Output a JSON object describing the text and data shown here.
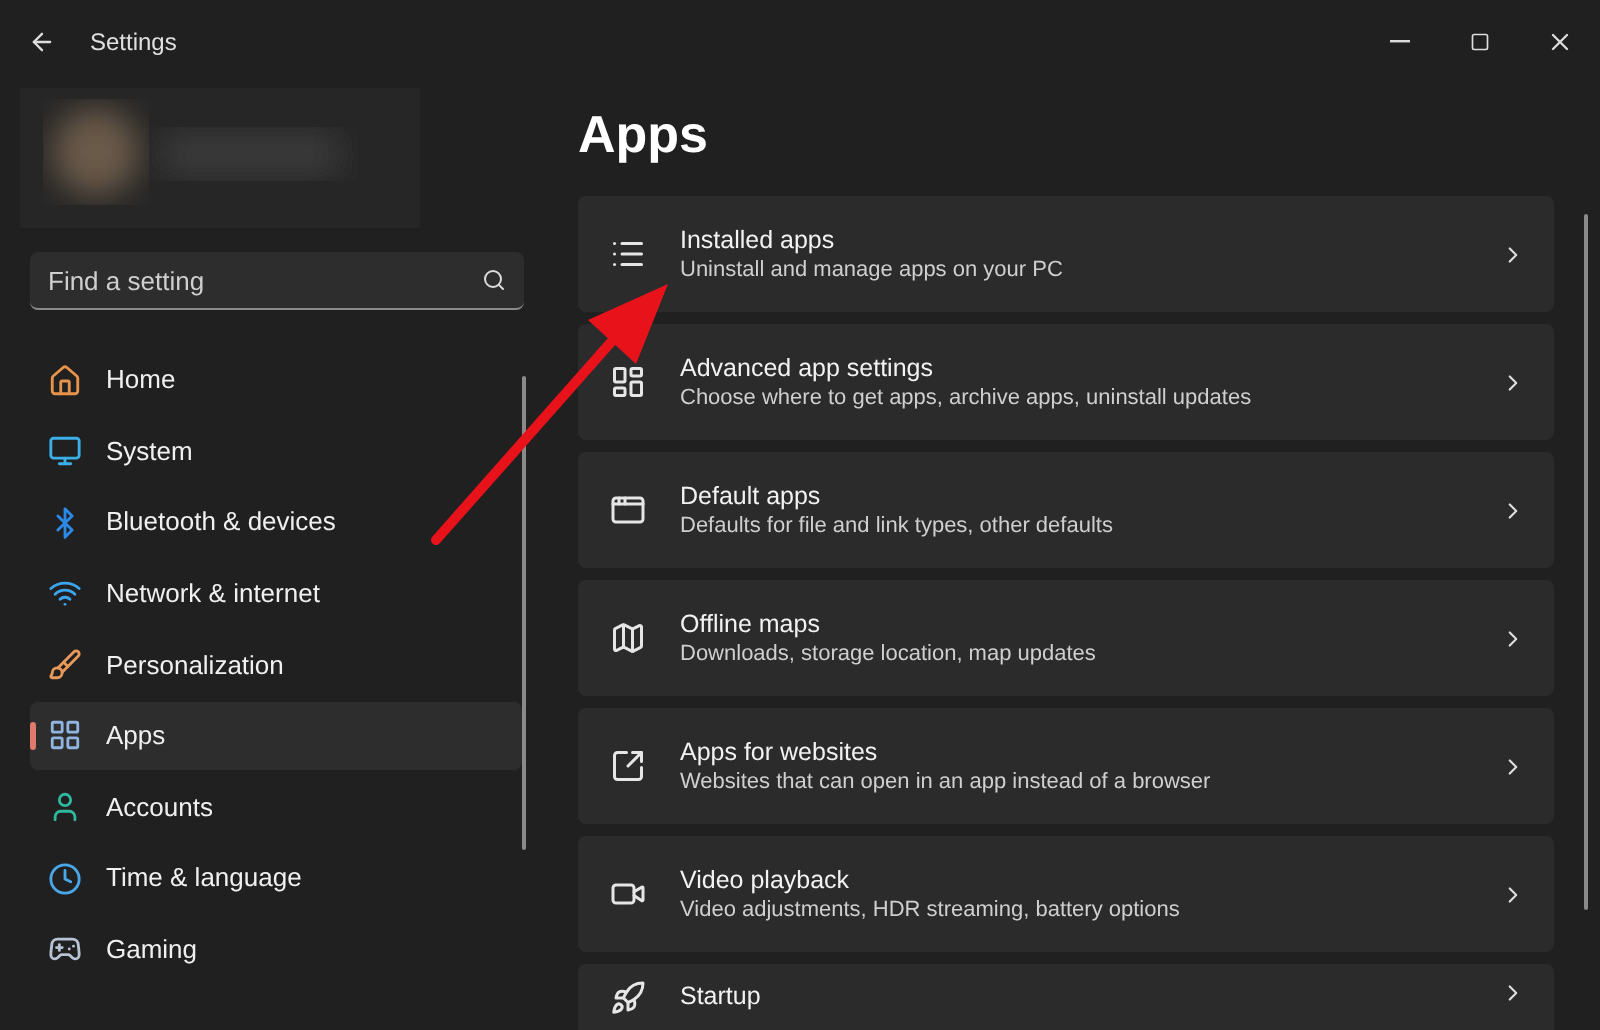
{
  "window": {
    "title": "Settings"
  },
  "search": {
    "placeholder": "Find a setting"
  },
  "sidebar": {
    "items": [
      {
        "label": "Home",
        "selected": false
      },
      {
        "label": "System",
        "selected": false
      },
      {
        "label": "Bluetooth & devices",
        "selected": false
      },
      {
        "label": "Network & internet",
        "selected": false
      },
      {
        "label": "Personalization",
        "selected": false
      },
      {
        "label": "Apps",
        "selected": true
      },
      {
        "label": "Accounts",
        "selected": false
      },
      {
        "label": "Time & language",
        "selected": false
      },
      {
        "label": "Gaming",
        "selected": false
      }
    ]
  },
  "page": {
    "title": "Apps",
    "cards": [
      {
        "title": "Installed apps",
        "description": "Uninstall and manage apps on your PC"
      },
      {
        "title": "Advanced app settings",
        "description": "Choose where to get apps, archive apps, uninstall updates"
      },
      {
        "title": "Default apps",
        "description": "Defaults for file and link types, other defaults"
      },
      {
        "title": "Offline maps",
        "description": "Downloads, storage location, map updates"
      },
      {
        "title": "Apps for websites",
        "description": "Websites that can open in an app instead of a browser"
      },
      {
        "title": "Video playback",
        "description": "Video adjustments, HDR streaming, battery options"
      },
      {
        "title": "Startup"
      }
    ]
  }
}
